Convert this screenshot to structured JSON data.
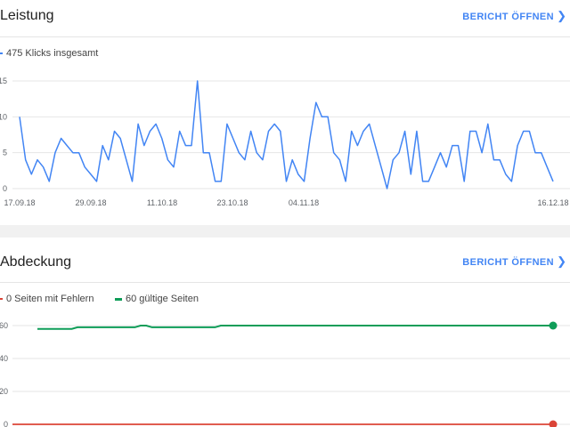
{
  "performance": {
    "title": "Leistung",
    "report_link": "BERICHT ÖFFNEN",
    "legend_label": "475 Klicks insgesamt",
    "colors": {
      "line": "#4285f4"
    }
  },
  "coverage": {
    "title": "Abdeckung",
    "report_link": "BERICHT ÖFFNEN",
    "legend_errors": "0 Seiten mit Fehlern",
    "legend_valid": "60 gültige Seiten",
    "colors": {
      "errors": "#db4437",
      "valid": "#0f9d58"
    }
  },
  "chart_data": [
    {
      "type": "line",
      "title": "",
      "xlabel": "",
      "ylabel": "",
      "ylim": [
        0,
        15
      ],
      "yticks": [
        "0",
        "5",
        "10",
        "15"
      ],
      "xticks": [
        "17.09.18",
        "29.09.18",
        "11.10.18",
        "23.10.18",
        "04.11.18",
        "16.12.18"
      ],
      "grid": true,
      "series": [
        {
          "name": "475 Klicks insgesamt",
          "values": [
            10,
            4,
            2,
            4,
            3,
            1,
            5,
            7,
            6,
            5,
            5,
            3,
            2,
            1,
            6,
            4,
            8,
            7,
            4,
            1,
            9,
            6,
            8,
            9,
            7,
            4,
            3,
            8,
            6,
            6,
            15,
            5,
            5,
            1,
            1,
            9,
            7,
            5,
            4,
            8,
            5,
            4,
            8,
            9,
            8,
            1,
            4,
            2,
            1,
            7,
            12,
            10,
            10,
            5,
            4,
            1,
            8,
            6,
            8,
            9,
            6,
            3,
            0,
            4,
            5,
            8,
            2,
            8,
            1,
            1,
            3,
            5,
            3,
            6,
            6,
            1,
            8,
            8,
            5,
            9,
            4,
            4,
            2,
            1,
            6,
            8,
            8,
            5,
            5,
            3,
            1
          ]
        }
      ]
    },
    {
      "type": "line",
      "title": "",
      "xlabel": "",
      "ylabel": "",
      "ylim": [
        0,
        60
      ],
      "yticks": [
        "0",
        "20",
        "40",
        "60"
      ],
      "grid": true,
      "series": [
        {
          "name": "60 gültige Seiten",
          "values": [
            58,
            58,
            58,
            58,
            58,
            58,
            58,
            59,
            59,
            59,
            59,
            59,
            59,
            59,
            59,
            59,
            59,
            59,
            60,
            60,
            59,
            59,
            59,
            59,
            59,
            59,
            59,
            59,
            59,
            59,
            59,
            59,
            60,
            60,
            60,
            60,
            60,
            60,
            60,
            60,
            60,
            60,
            60,
            60,
            60,
            60,
            60,
            60,
            60,
            60,
            60,
            60,
            60,
            60,
            60,
            60,
            60,
            60,
            60,
            60,
            60,
            60,
            60,
            60,
            60,
            60,
            60,
            60,
            60,
            60,
            60,
            60,
            60,
            60,
            60,
            60,
            60,
            60,
            60,
            60,
            60,
            60,
            60,
            60,
            60,
            60,
            60,
            60,
            60,
            60,
            60
          ]
        },
        {
          "name": "0 Seiten mit Fehlern",
          "values": [
            0,
            0,
            0,
            0,
            0,
            0,
            0,
            0,
            0,
            0,
            0,
            0,
            0,
            0,
            0,
            0,
            0,
            0,
            0,
            0,
            0,
            0,
            0,
            0,
            0,
            0,
            0,
            0,
            0,
            0,
            0,
            0,
            0,
            0,
            0,
            0,
            0,
            0,
            0,
            0,
            0,
            0,
            0,
            0,
            0,
            0,
            0,
            0,
            0,
            0,
            0,
            0,
            0,
            0,
            0,
            0,
            0,
            0,
            0,
            0,
            0,
            0,
            0,
            0,
            0,
            0,
            0,
            0,
            0,
            0,
            0,
            0,
            0,
            0,
            0,
            0,
            0,
            0,
            0,
            0,
            0,
            0,
            0,
            0,
            0,
            0,
            0,
            0,
            0,
            0,
            0
          ]
        }
      ]
    }
  ]
}
